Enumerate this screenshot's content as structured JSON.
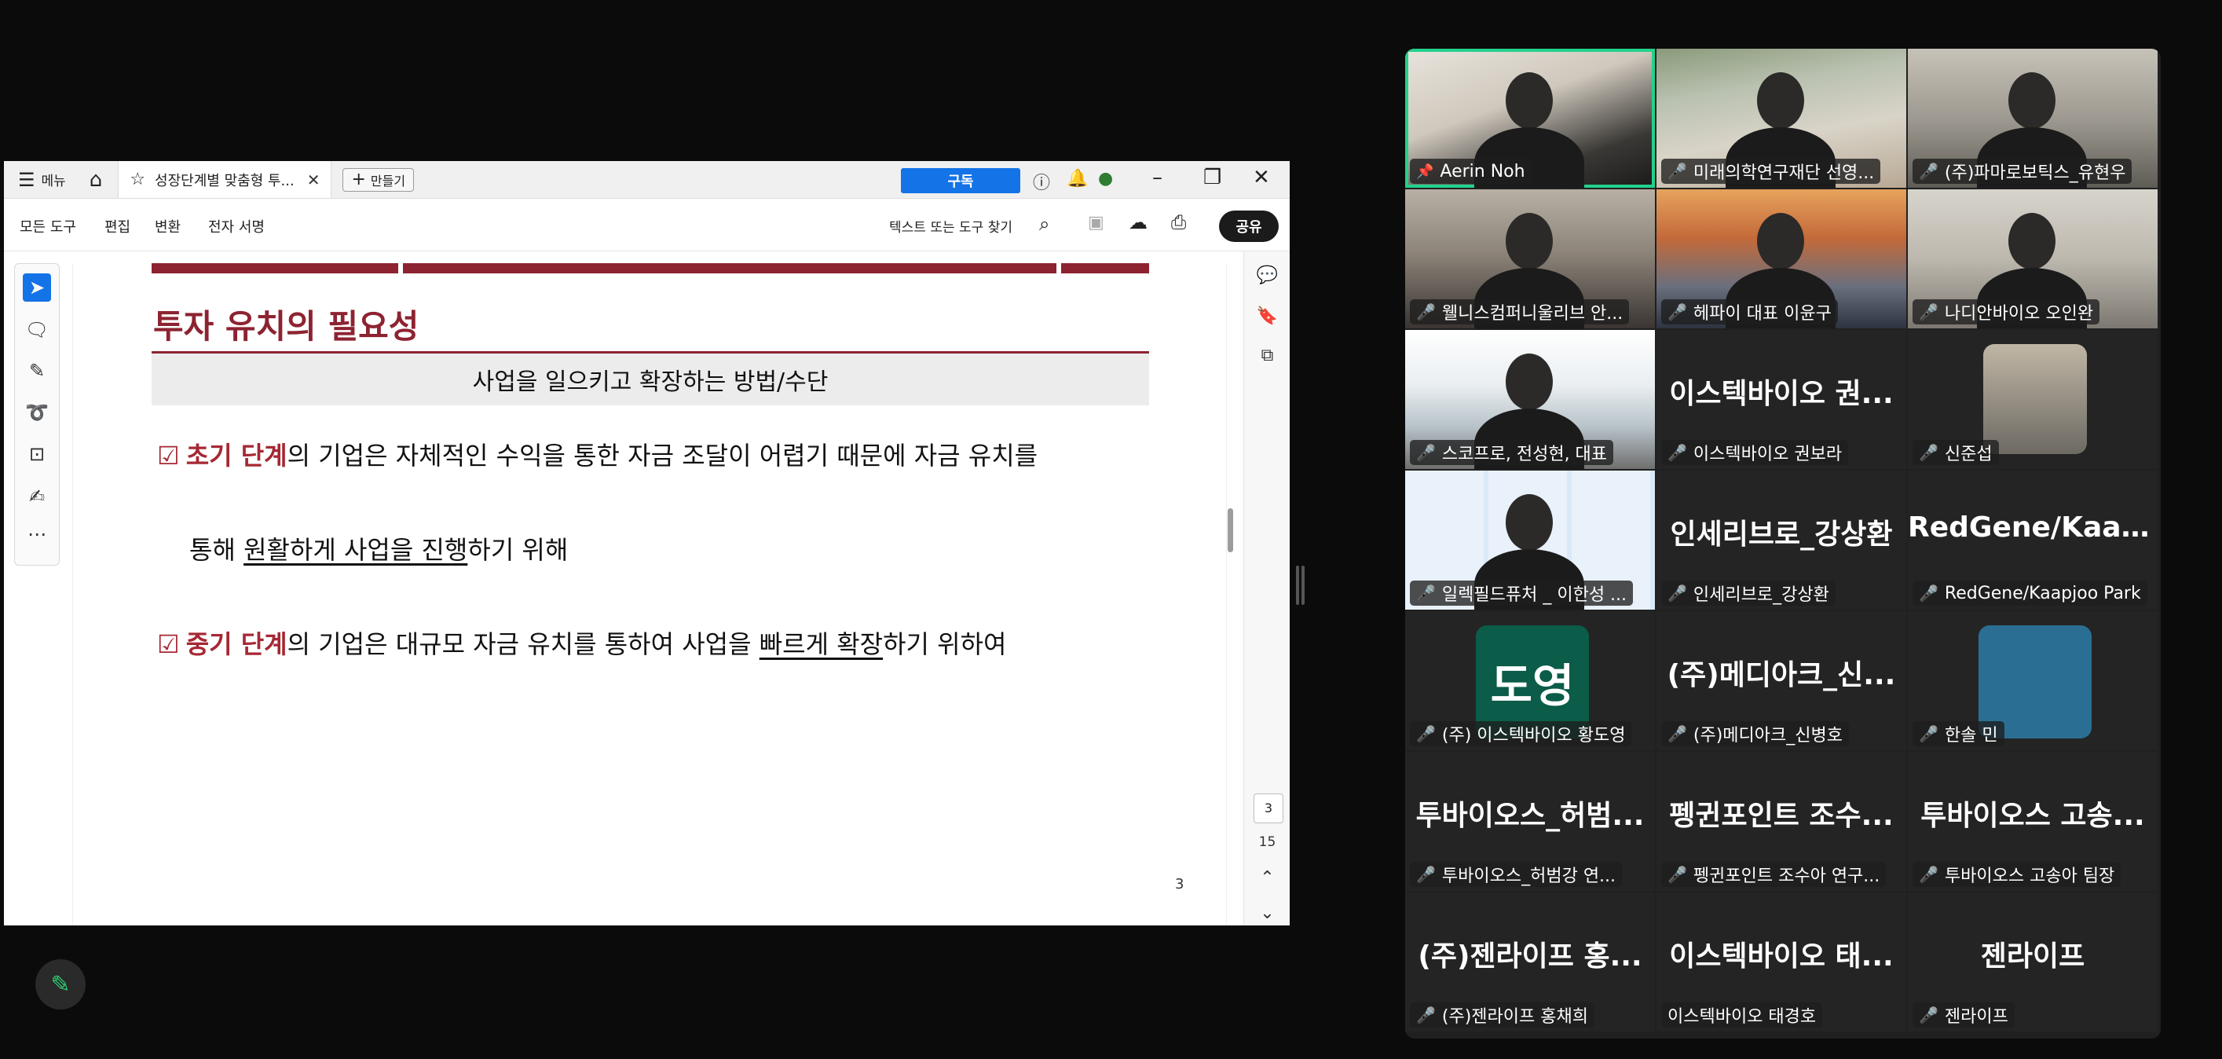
{
  "viewer": {
    "menu_label": "메뉴",
    "tab_title": "성장단계별 맞춤형 투...",
    "new_label": "만들기",
    "subscribe_label": "구독",
    "tools": [
      "모든 도구",
      "편집",
      "변환",
      "전자 서명"
    ],
    "search_label": "텍스트 또는 도구 찾기",
    "share_label": "공유",
    "current_page": "3",
    "total_pages": "15"
  },
  "slide": {
    "title": "투자 유치의 필요성",
    "subtitle": "사업을 일으키고 확장하는 방법/수단",
    "bullet1": {
      "check": "☑",
      "highlight": "초기 단계",
      "text_a": "의 기업은 자체적인 수익을 통한 자금 조달이 어렵기 때문에 자금 유치를",
      "text_b_pre": "통해 ",
      "text_b_u": "원활하게 사업을 진행",
      "text_b_post": "하기 위해"
    },
    "bullet2": {
      "check": "☑",
      "highlight": "중기 단계",
      "text_pre": "의 기업은 대규모 자금 유치를 통하여 사업을 ",
      "text_u": "빠르게 확장",
      "text_post": "하기 위하여"
    },
    "page_number": "3"
  },
  "participants": [
    {
      "name": "Aerin Noh",
      "big": "",
      "muted": false,
      "pinned": true,
      "kind": "video1"
    },
    {
      "name": "미래의학연구재단 선영...",
      "big": "",
      "muted": true,
      "kind": "video2"
    },
    {
      "name": "(주)파마로보틱스_유현우",
      "big": "",
      "muted": true,
      "kind": "video3"
    },
    {
      "name": "웰니스컴퍼니울리브 안...",
      "big": "",
      "muted": true,
      "kind": "video4"
    },
    {
      "name": "헤파이 대표 이윤구",
      "big": "",
      "muted": true,
      "kind": "video5"
    },
    {
      "name": "나디안바이오 오인완",
      "big": "",
      "muted": true,
      "kind": "video6"
    },
    {
      "name": "스코프로, 전성현, 대표",
      "big": "",
      "muted": true,
      "kind": "video7"
    },
    {
      "name": "이스텍바이오 권보라",
      "big": "이스텍바이오 권...",
      "muted": true,
      "kind": "text"
    },
    {
      "name": "신준섭",
      "big": "",
      "muted": true,
      "kind": "photo"
    },
    {
      "name": "일렉필드퓨처 _ 이한성 ...",
      "big": "",
      "muted": true,
      "kind": "video10"
    },
    {
      "name": "인세리브로_강상환",
      "big": "인세리브로_강상환",
      "muted": true,
      "kind": "text"
    },
    {
      "name": "RedGene/Kaapjoo Park",
      "big": "RedGene/Kaapj...",
      "muted": true,
      "kind": "text"
    },
    {
      "name": "(주) 이스텍바이오 황도영",
      "big": "",
      "avatar_text": "도영",
      "muted": true,
      "kind": "avatar"
    },
    {
      "name": "(주)메디아크_신병호",
      "big": "(주)메디아크_신...",
      "muted": true,
      "kind": "text"
    },
    {
      "name": "한솔 민",
      "big": "",
      "muted": true,
      "kind": "avatarbox"
    },
    {
      "name": "투바이오스_허범강 연...",
      "big": "투바이오스_허범...",
      "muted": true,
      "kind": "text"
    },
    {
      "name": "펭귄포인트 조수아 연구...",
      "big": "펭귄포인트 조수...",
      "muted": true,
      "kind": "text"
    },
    {
      "name": "투바이오스 고송아 팀장",
      "big": "투바이오스 고송...",
      "muted": true,
      "kind": "text"
    },
    {
      "name": "(주)젠라이프 홍채희",
      "big": "(주)젠라이프 홍...",
      "muted": true,
      "kind": "text"
    },
    {
      "name": "이스텍바이오 태경호",
      "big": "이스텍바이오 태...",
      "muted": false,
      "kind": "text"
    },
    {
      "name": "젠라이프",
      "big": "젠라이프",
      "muted": true,
      "kind": "text"
    }
  ],
  "colors": {
    "accent_blue": "#1473e6",
    "slide_red": "#8d2331",
    "active_speaker": "#23d18b",
    "mute_red": "#e0454f"
  }
}
